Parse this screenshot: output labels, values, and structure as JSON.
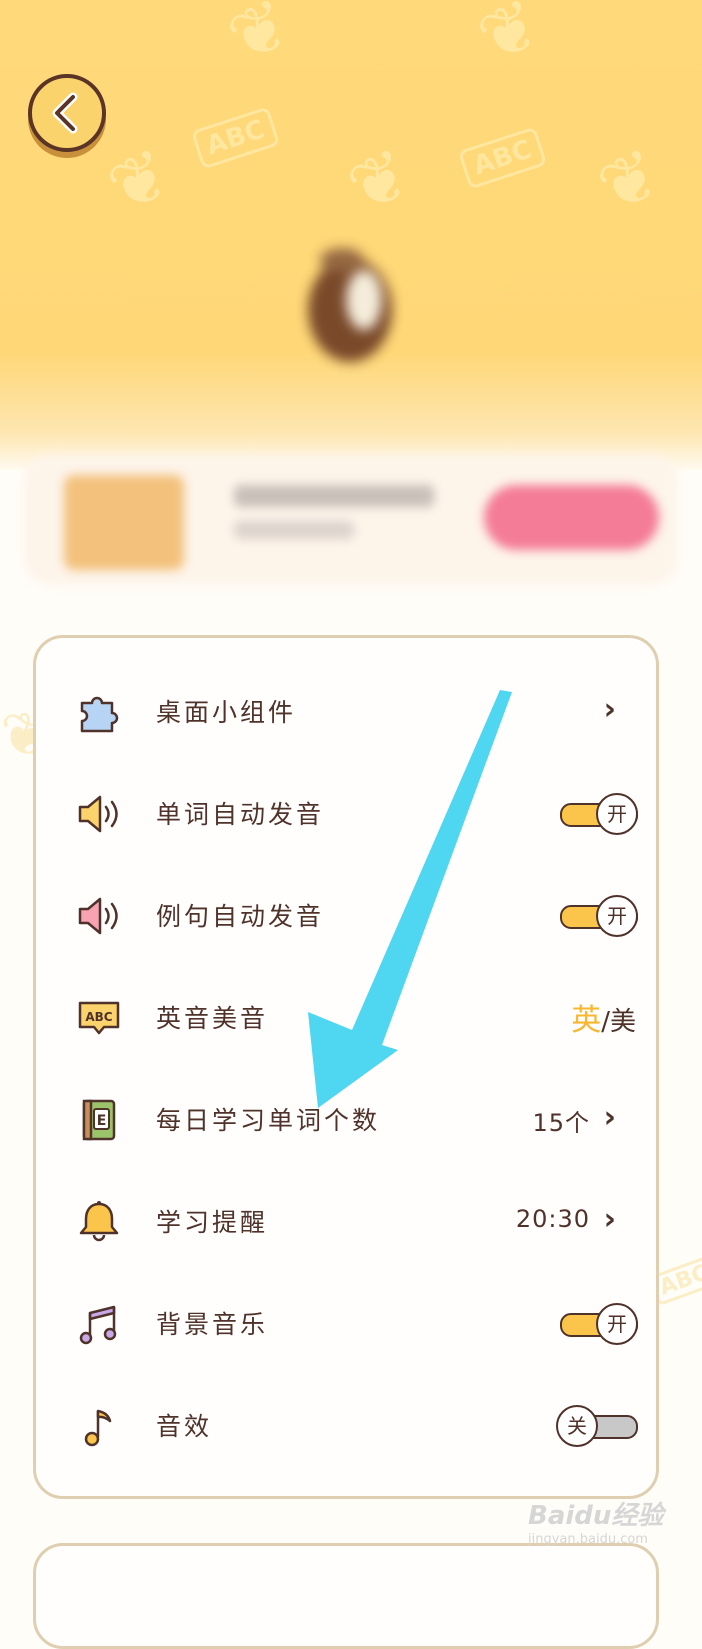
{
  "colors": {
    "hero_background": "#ffd777",
    "accent_yellow": "#fbc54b",
    "text_brown": "#4f322a",
    "card_border": "#dfcfb0",
    "arrow_cyan": "#4fd6f0",
    "cta_pink": "#f47c97"
  },
  "header": {
    "back_icon": "chevron-left-icon",
    "hero_decoration": [
      "ABC",
      "ABC",
      "ABC"
    ]
  },
  "settings": {
    "rows": [
      {
        "label": "桌面小组件",
        "icon": "puzzle-icon",
        "control": "chevron"
      },
      {
        "label": "单词自动发音",
        "icon": "speaker-icon",
        "control": "toggle",
        "state_text": "开"
      },
      {
        "label": "例句自动发音",
        "icon": "speaker-pink-icon",
        "control": "toggle",
        "state_text": "开"
      },
      {
        "label": "英音美音",
        "icon": "abc-bubble-icon",
        "control": "segmented",
        "option_active": "英",
        "separator": "/",
        "option_inactive": "美"
      },
      {
        "label": "每日学习单词个数",
        "icon": "book-icon",
        "control": "value",
        "value": "15个"
      },
      {
        "label": "学习提醒",
        "icon": "bell-icon",
        "control": "value",
        "value": "20:30"
      },
      {
        "label": "背景音乐",
        "icon": "music-notes-icon",
        "control": "toggle",
        "state_text": "开"
      },
      {
        "label": "音效",
        "icon": "music-note-icon",
        "control": "toggle",
        "state_text": "关"
      }
    ]
  },
  "watermark": {
    "text": "Baidu经验",
    "sub": "jingyan.baidu.com"
  }
}
